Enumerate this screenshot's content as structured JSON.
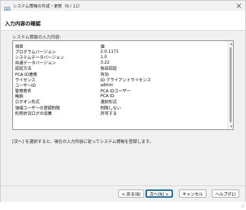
{
  "window": {
    "title": "システム情報の作成・更新（9 / 11）"
  },
  "header": {
    "title": "入力内容の確認"
  },
  "content": {
    "section_label": "システム情報の入力内容:",
    "instruction": "[次へ] を選択すると、現在の入力内容に従ってシステム情報を登録します。"
  },
  "table": {
    "columns": {
      "item": "項目",
      "value": "値"
    },
    "rows": [
      {
        "item": "プログラムバージョン",
        "value": "2.0.1171"
      },
      {
        "item": "システムデータバージョン",
        "value": "1.0"
      },
      {
        "item": "共通データバージョン",
        "value": "3.22"
      },
      {
        "item": "認証方法",
        "value": "独自認証"
      },
      {
        "item": "PCA ID連携",
        "value": "有効"
      },
      {
        "item": "ライセンス",
        "value": "ID クライアントライセンス"
      },
      {
        "item": "ユーザーID",
        "value": "admin"
      },
      {
        "item": "管理者名",
        "value": "PCA IDユーザー"
      },
      {
        "item": "略称",
        "value": "PCA ID"
      },
      {
        "item": "ログオン形式",
        "value": "選択形式"
      },
      {
        "item": "領域ユーザーの登録制限",
        "value": "制限しない"
      },
      {
        "item": "利用状況ログの収集",
        "value": "許可する"
      }
    ]
  },
  "buttons": {
    "back": "< 戻る(B)",
    "next": "次へ(N) >",
    "cancel": "キャンセル",
    "help": "ヘルプ(F1)"
  },
  "colors": {
    "accent": "#0067c0",
    "body_bg": "#f0f0f0",
    "titlebar_bg": "#f3f3f3"
  },
  "icons": {
    "app": "app-window-icon",
    "close": "close-icon"
  }
}
